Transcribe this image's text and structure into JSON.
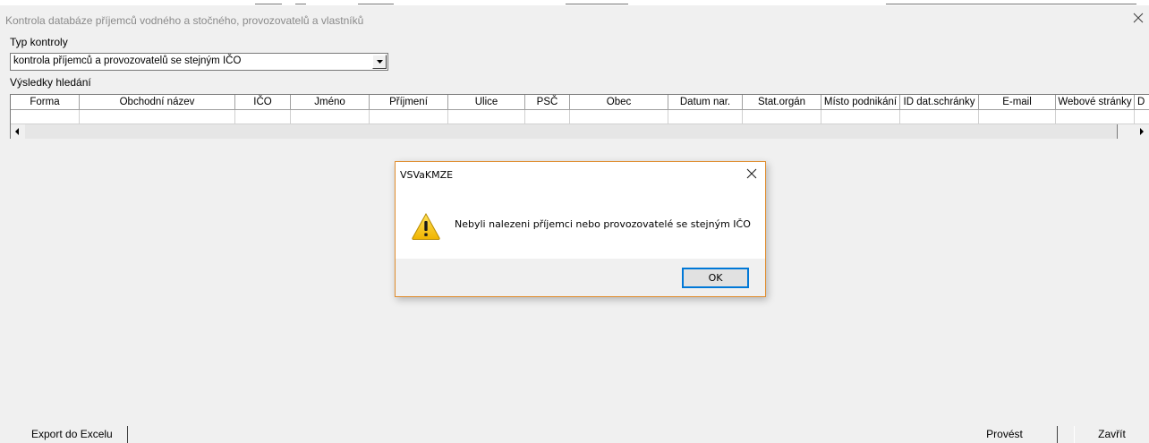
{
  "window": {
    "title": "Kontrola databáze příjemců vodného a stočného, provozovatelů a vlastníků"
  },
  "check_type": {
    "label": "Typ kontroly",
    "selected": "kontrola příjemců a provozovatelů se stejným IČO"
  },
  "results": {
    "label": "Výsledky hledání",
    "columns": [
      "Forma",
      "Obchodní název",
      "IČO",
      "Jméno",
      "Příjmení",
      "Ulice",
      "PSČ",
      "Obec",
      "Datum nar.",
      "Stat.orgán",
      "Místo podnikání",
      "ID dat.schránky",
      "E-mail",
      "Webové stránky",
      "D"
    ]
  },
  "dialog": {
    "title": "VSVaKMZE",
    "message": "Nebyli nalezeni příjemci nebo provozovatelé se stejným IČO",
    "ok_label": "OK",
    "icon": "warning-icon"
  },
  "buttons": {
    "export": "Export do Excelu",
    "run": "Provést",
    "close": "Zavřít"
  },
  "colors": {
    "dialog_border": "#e08d2e",
    "ok_focus": "#0078d7"
  }
}
